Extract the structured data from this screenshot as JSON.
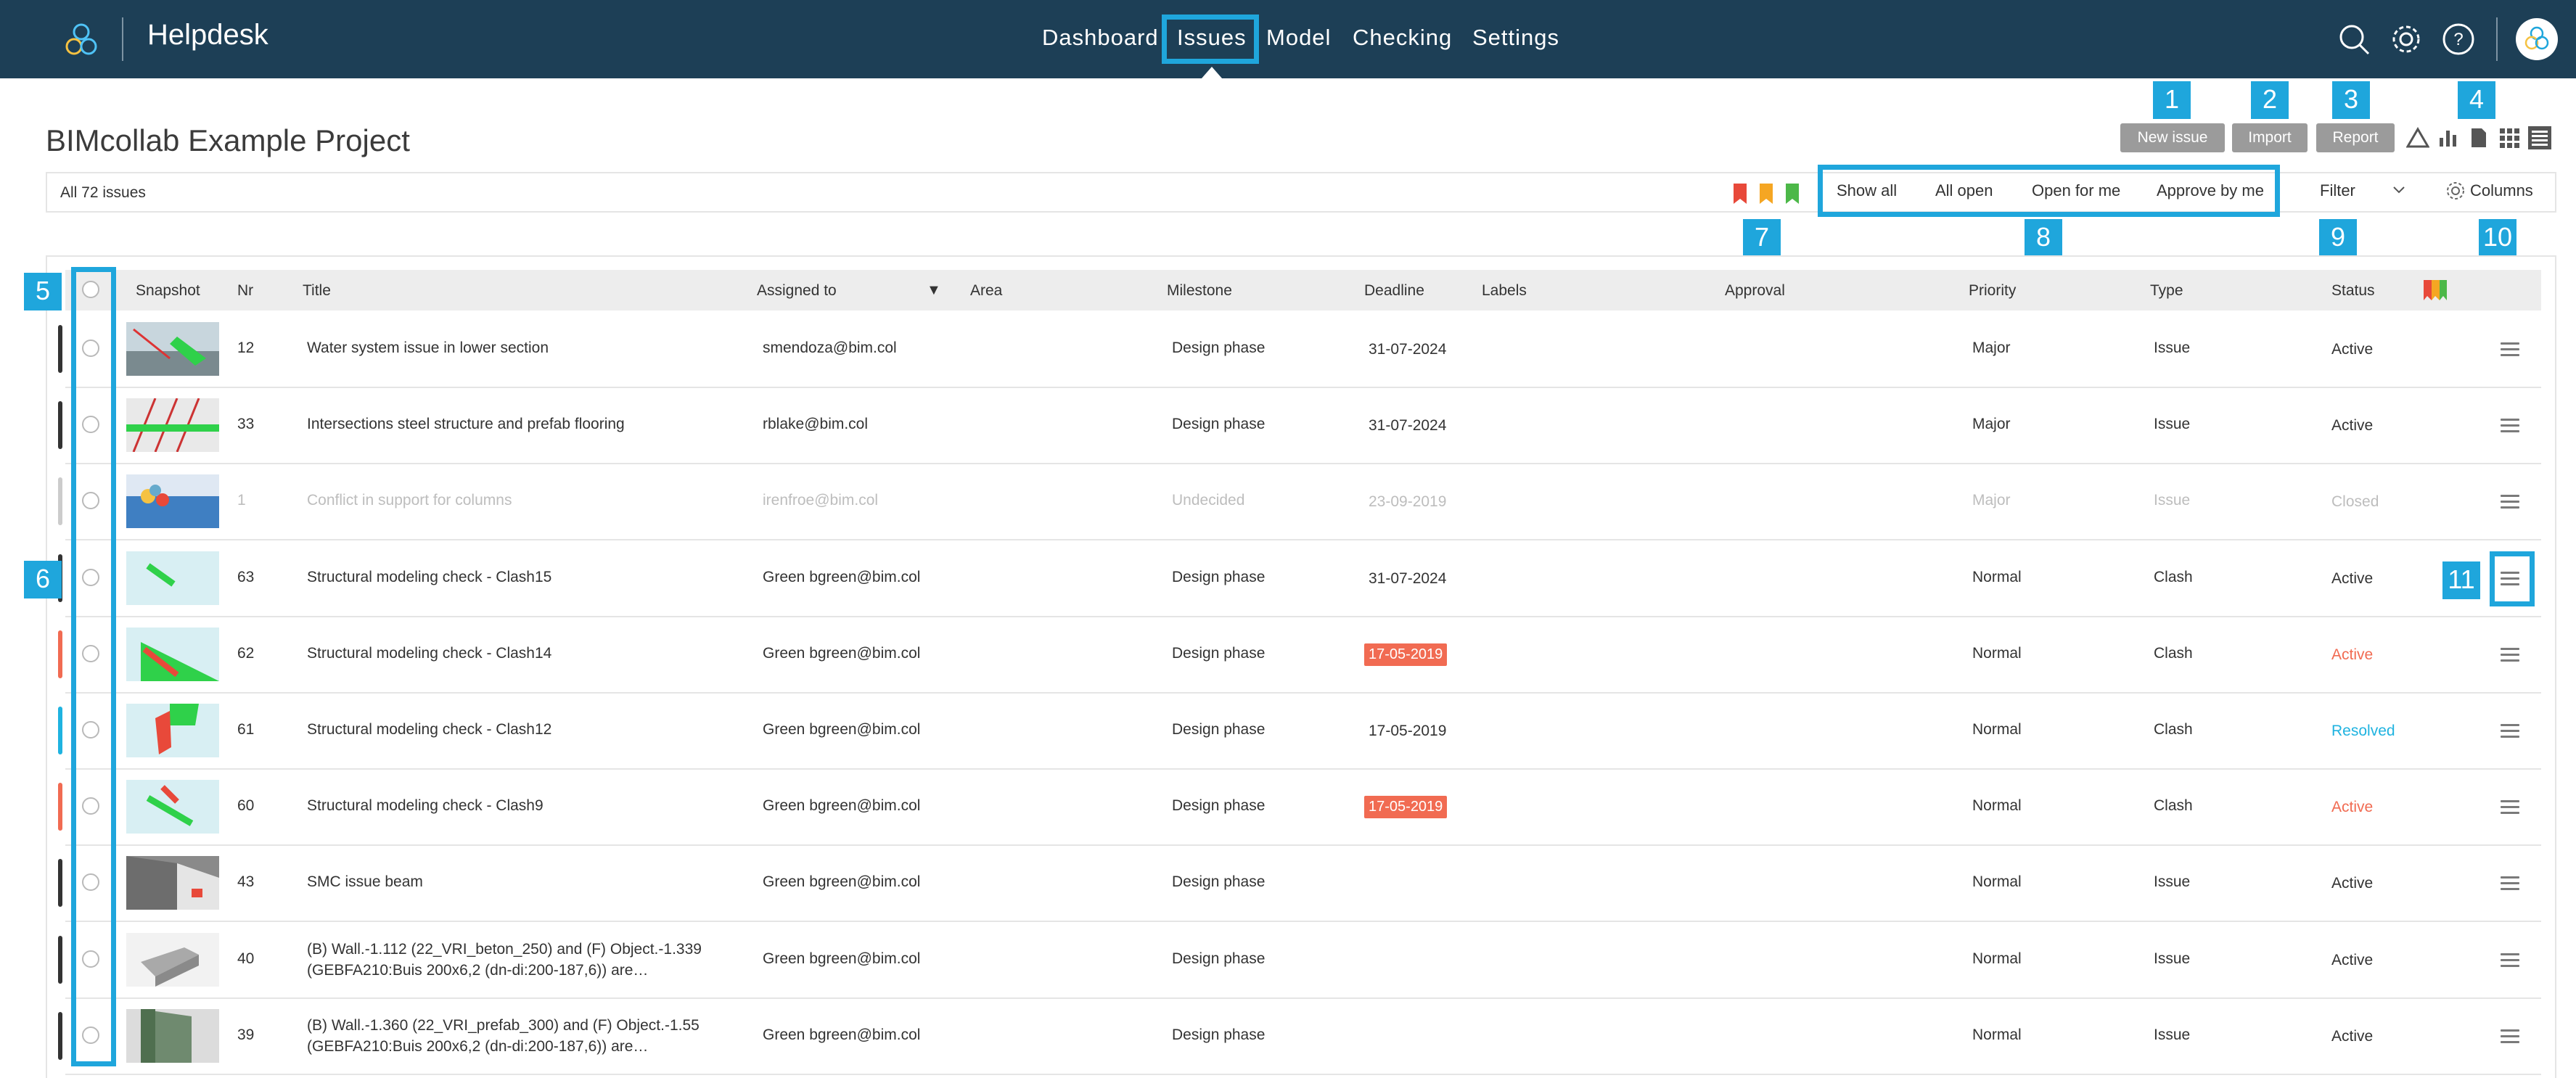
{
  "header": {
    "app_name": "Helpdesk",
    "nav": [
      "Dashboard",
      "Issues",
      "Model",
      "Checking",
      "Settings"
    ],
    "active_nav": "Issues",
    "icons": [
      "search-icon",
      "gear-icon",
      "help-icon",
      "avatar"
    ]
  },
  "project": {
    "title": "BIMcollab Example Project"
  },
  "toolbar": {
    "new_issue": "New issue",
    "import": "Import",
    "report": "Report",
    "view_icons": [
      "triangle-icon",
      "bar-chart-icon",
      "document-icon",
      "grid-icon",
      "list-icon"
    ]
  },
  "callouts": [
    "1",
    "2",
    "3",
    "4",
    "5",
    "6",
    "7",
    "8",
    "9",
    "10",
    "11"
  ],
  "filterbar": {
    "count_label": "All 72 issues",
    "flag_colors": [
      "#e8493a",
      "#f5a623",
      "#4cb848"
    ],
    "quick_filters": [
      "Show all",
      "All open",
      "Open for me",
      "Approve by me"
    ],
    "filter_label": "Filter",
    "columns_label": "Columns"
  },
  "table": {
    "headers": [
      "Snapshot",
      "Nr",
      "Title",
      "Assigned to",
      "Area",
      "Milestone",
      "Deadline",
      "Labels",
      "Approval",
      "Priority",
      "Type",
      "Status"
    ],
    "rows": [
      {
        "bar": "#333333",
        "nr": "12",
        "title": "Water system issue in lower section",
        "assigned": "smendoza@bim.col",
        "milestone": "Design phase",
        "deadline": "31-07-2024",
        "deadline_overdue": false,
        "priority": "Major",
        "type": "Issue",
        "status": "Active",
        "status_color": "#333333",
        "muted": false
      },
      {
        "bar": "#333333",
        "nr": "33",
        "title": "Intersections steel structure and prefab flooring",
        "assigned": "rblake@bim.col",
        "milestone": "Design phase",
        "deadline": "31-07-2024",
        "deadline_overdue": false,
        "priority": "Major",
        "type": "Issue",
        "status": "Active",
        "status_color": "#333333",
        "muted": false
      },
      {
        "bar": "#cccccc",
        "nr": "1",
        "title": "Conflict in support for columns",
        "assigned": "irenfroe@bim.col",
        "milestone": "Undecided",
        "deadline": "23-09-2019",
        "deadline_overdue": false,
        "priority": "Major",
        "type": "Issue",
        "status": "Closed",
        "status_color": "#bdbdbd",
        "muted": true
      },
      {
        "bar": "#333333",
        "nr": "63",
        "title": "Structural modeling check - Clash15",
        "assigned": "Green bgreen@bim.col",
        "milestone": "Design phase",
        "deadline": "31-07-2024",
        "deadline_overdue": false,
        "priority": "Normal",
        "type": "Clash",
        "status": "Active",
        "status_color": "#333333",
        "muted": false
      },
      {
        "bar": "#f16b52",
        "nr": "62",
        "title": "Structural modeling check - Clash14",
        "assigned": "Green bgreen@bim.col",
        "milestone": "Design phase",
        "deadline": "17-05-2019",
        "deadline_overdue": true,
        "priority": "Normal",
        "type": "Clash",
        "status": "Active",
        "status_color": "#f16b52",
        "muted": false
      },
      {
        "bar": "#1fb3e0",
        "nr": "61",
        "title": "Structural modeling check - Clash12",
        "assigned": "Green bgreen@bim.col",
        "milestone": "Design phase",
        "deadline": "17-05-2019",
        "deadline_overdue": false,
        "priority": "Normal",
        "type": "Clash",
        "status": "Resolved",
        "status_color": "#1fb3e0",
        "muted": false
      },
      {
        "bar": "#f16b52",
        "nr": "60",
        "title": "Structural modeling check - Clash9",
        "assigned": "Green bgreen@bim.col",
        "milestone": "Design phase",
        "deadline": "17-05-2019",
        "deadline_overdue": true,
        "priority": "Normal",
        "type": "Clash",
        "status": "Active",
        "status_color": "#f16b52",
        "muted": false
      },
      {
        "bar": "#333333",
        "nr": "43",
        "title": "SMC issue beam",
        "assigned": "Green bgreen@bim.col",
        "milestone": "Design phase",
        "deadline": "",
        "deadline_overdue": false,
        "priority": "Normal",
        "type": "Issue",
        "status": "Active",
        "status_color": "#333333",
        "muted": false
      },
      {
        "bar": "#333333",
        "nr": "40",
        "title": "(B) Wall.-1.112 (22_VRI_beton_250) and (F) Object.-1.339 (GEBFA210:Buis 200x6,2 (dn-di:200-187,6)) are…",
        "assigned": "Green bgreen@bim.col",
        "milestone": "Design phase",
        "deadline": "",
        "deadline_overdue": false,
        "priority": "Normal",
        "type": "Issue",
        "status": "Active",
        "status_color": "#333333",
        "muted": false
      },
      {
        "bar": "#333333",
        "nr": "39",
        "title": "(B) Wall.-1.360 (22_VRI_prefab_300) and (F) Object.-1.55 (GEBFA210:Buis 200x6,2 (dn-di:200-187,6)) are…",
        "assigned": "Green bgreen@bim.col",
        "milestone": "Design phase",
        "deadline": "",
        "deadline_overdue": false,
        "priority": "Normal",
        "type": "Issue",
        "status": "Active",
        "status_color": "#333333",
        "muted": false
      }
    ]
  }
}
